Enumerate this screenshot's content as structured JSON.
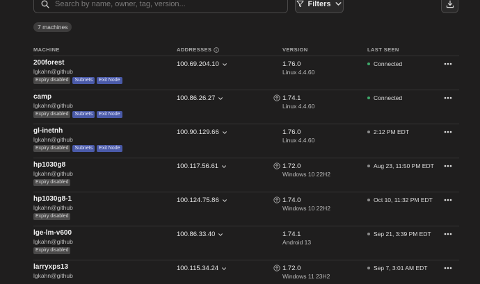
{
  "search": {
    "placeholder": "Search by name, owner, tag, version..."
  },
  "filters": {
    "label": "Filters"
  },
  "machine_count": "7 machines",
  "columns": {
    "machine": "MACHINE",
    "addresses": "ADDRESSES",
    "version": "VERSION",
    "last_seen": "LAST SEEN"
  },
  "colors": {
    "background": "#1f1e1e",
    "connected": "#3fa86a",
    "tag_blue": "#4a5aa8",
    "tag_gray": "#4a4949"
  },
  "machines": [
    {
      "name": "200forest",
      "owner": "lgkahn@github",
      "tags": [
        "Expiry disabled",
        "Subnets",
        "Exit Node"
      ],
      "address": "100.69.204.10",
      "update_available": false,
      "version": "1.76.0",
      "os": "Linux 4.4.60",
      "status": "connected",
      "last_seen": "Connected"
    },
    {
      "name": "camp",
      "owner": "lgkahn@github",
      "tags": [
        "Expiry disabled",
        "Subnets",
        "Exit Node"
      ],
      "address": "100.86.26.27",
      "update_available": true,
      "version": "1.74.1",
      "os": "Linux 4.4.60",
      "status": "connected",
      "last_seen": "Connected"
    },
    {
      "name": "gl-inetnh",
      "owner": "lgkahn@github",
      "tags": [
        "Expiry disabled",
        "Subnets",
        "Exit Node"
      ],
      "address": "100.90.129.66",
      "update_available": false,
      "version": "1.76.0",
      "os": "Linux 4.4.60",
      "status": "offline",
      "last_seen": "2:12 PM EDT"
    },
    {
      "name": "hp1030g8",
      "owner": "lgkahn@github",
      "tags": [
        "Expiry disabled"
      ],
      "address": "100.117.56.61",
      "update_available": true,
      "version": "1.72.0",
      "os": "Windows 10 22H2",
      "status": "offline",
      "last_seen": "Aug 23, 11:50 PM EDT"
    },
    {
      "name": "hp1030g8-1",
      "owner": "lgkahn@github",
      "tags": [
        "Expiry disabled"
      ],
      "address": "100.124.75.86",
      "update_available": true,
      "version": "1.74.0",
      "os": "Windows 10 22H2",
      "status": "offline",
      "last_seen": "Oct 10, 11:32 PM EDT"
    },
    {
      "name": "lge-lm-v600",
      "owner": "lgkahn@github",
      "tags": [
        "Expiry disabled"
      ],
      "address": "100.86.33.40",
      "update_available": false,
      "version": "1.74.1",
      "os": "Android 13",
      "status": "offline",
      "last_seen": "Sep 21, 3:39 PM EDT"
    },
    {
      "name": "larryxps13",
      "owner": "lgkahn@github",
      "tags": [],
      "address": "100.115.34.24",
      "update_available": true,
      "version": "1.72.0",
      "os": "Windows 11 23H2",
      "status": "offline",
      "last_seen": "Sep 7, 3:01 AM EDT"
    }
  ]
}
